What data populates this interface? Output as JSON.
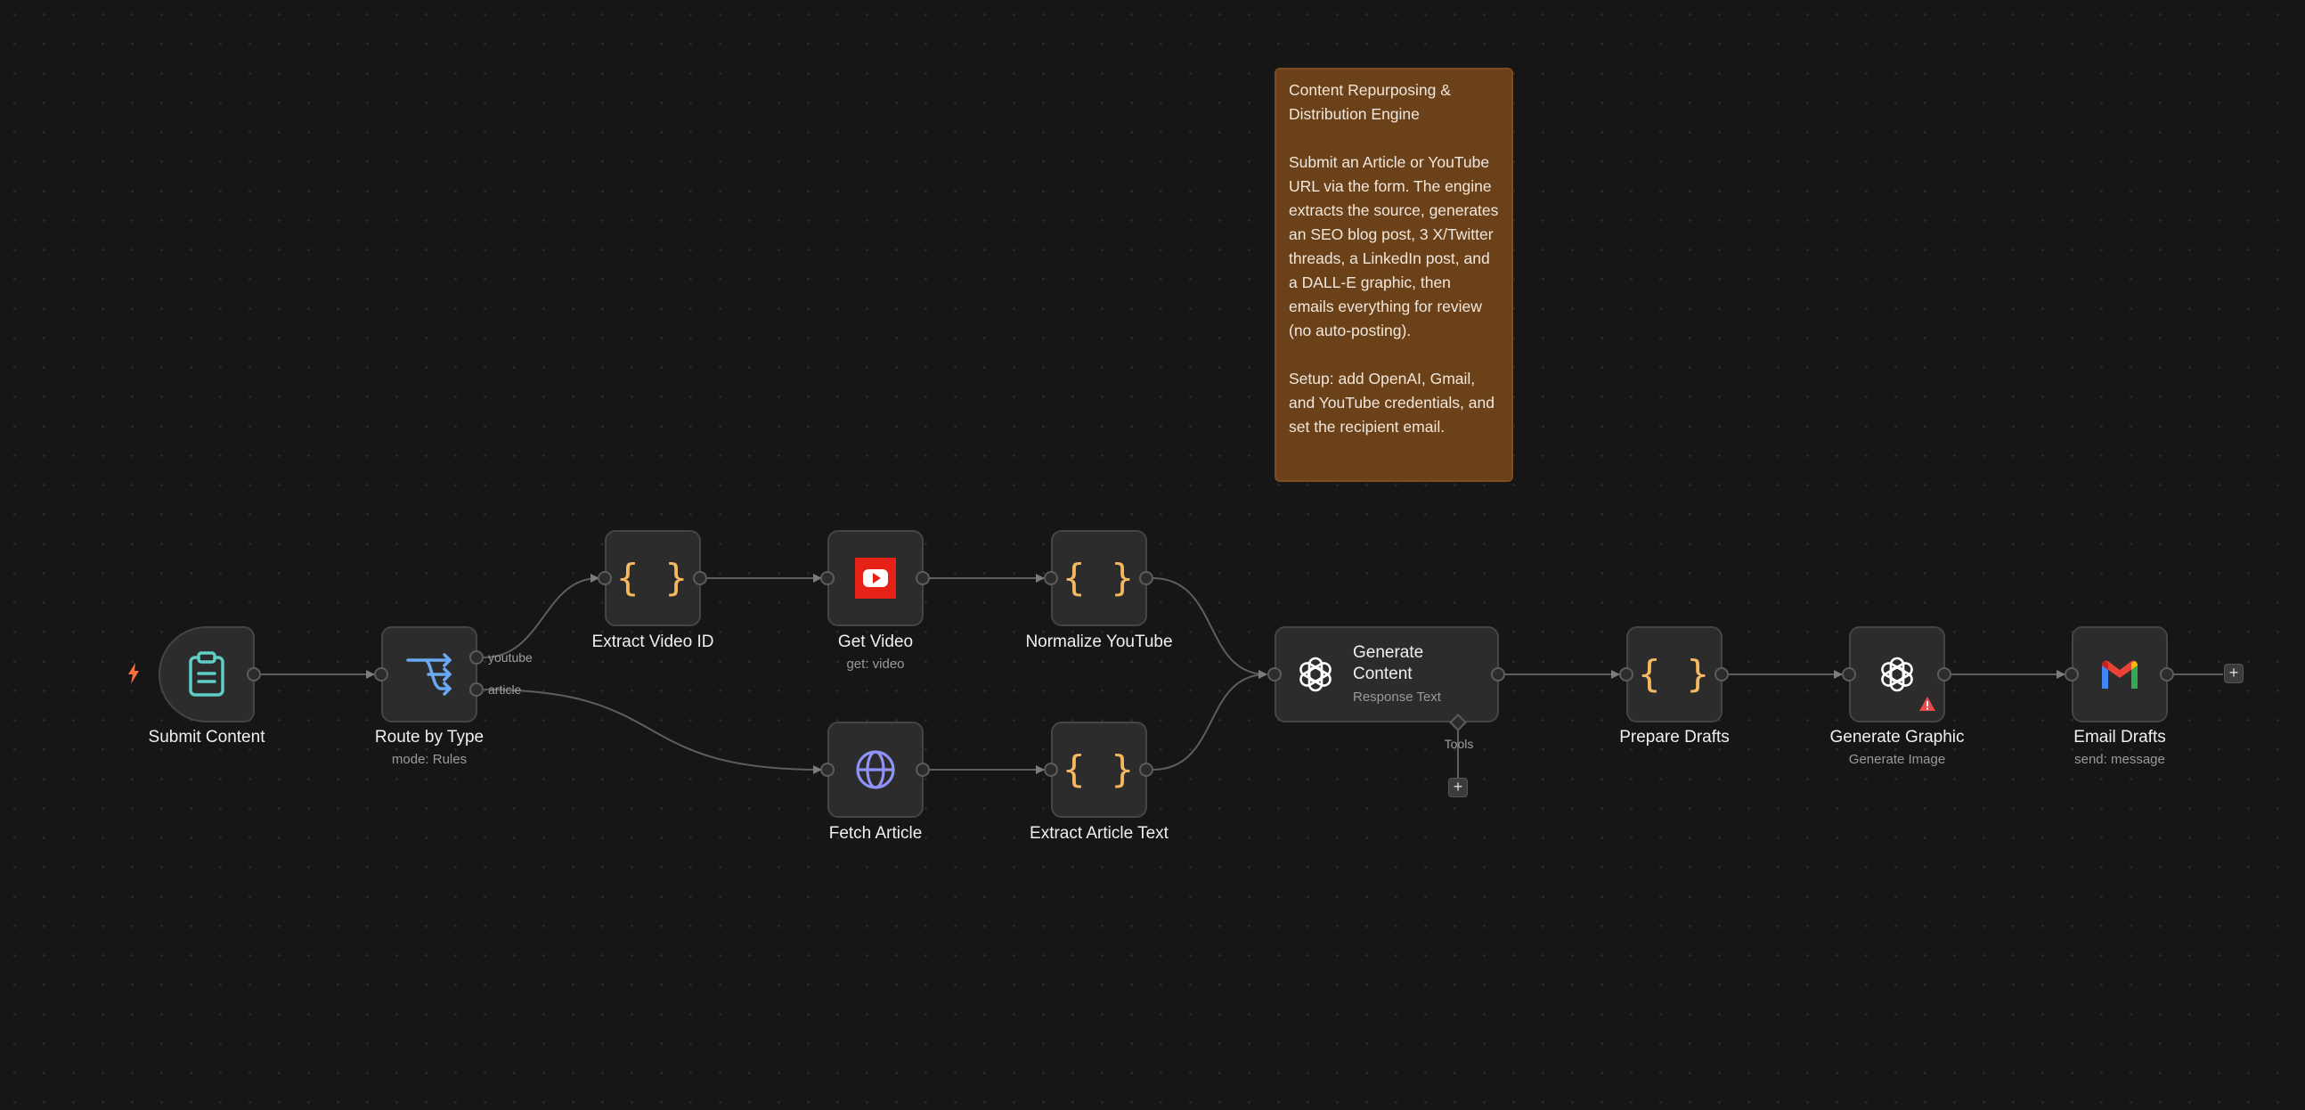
{
  "workflow": {
    "sticky_note": {
      "title": "Content Repurposing & Distribution Engine",
      "body": "Submit an Article or YouTube URL via the form. The engine extracts the source, generates an SEO blog post, 3 X/Twitter threads, a LinkedIn post, and a DALL-E graphic, then emails everything for review (no auto-posting).",
      "setup": "Setup: add OpenAI, Gmail, and YouTube credentials, and set the recipient email."
    },
    "nodes": {
      "submit_content": {
        "label": "Submit Content",
        "icon": "clipboard-icon"
      },
      "route_by_type": {
        "label": "Route by Type",
        "subtitle": "mode: Rules",
        "icon": "switch-icon",
        "outputs": [
          "youtube",
          "article"
        ]
      },
      "extract_video_id": {
        "label": "Extract Video ID",
        "icon": "code-braces-icon",
        "glyph": "{ }"
      },
      "get_video": {
        "label": "Get Video",
        "subtitle": "get: video",
        "icon": "youtube-icon"
      },
      "normalize_youtube": {
        "label": "Normalize YouTube",
        "icon": "code-braces-icon",
        "glyph": "{ }"
      },
      "fetch_article": {
        "label": "Fetch Article",
        "icon": "globe-icon"
      },
      "extract_article_text": {
        "label": "Extract Article Text",
        "icon": "code-braces-icon",
        "glyph": "{ }"
      },
      "generate_content": {
        "label": "Generate Content",
        "subtitle": "Response Text",
        "icon": "openai-icon",
        "tools_label": "Tools"
      },
      "prepare_drafts": {
        "label": "Prepare Drafts",
        "icon": "code-braces-icon",
        "glyph": "{ }"
      },
      "generate_graphic": {
        "label": "Generate Graphic",
        "subtitle": "Generate Image",
        "icon": "openai-icon",
        "warning": "warning-icon"
      },
      "email_drafts": {
        "label": "Email Drafts",
        "subtitle": "send: message",
        "icon": "gmail-icon"
      }
    },
    "add_button": "+"
  },
  "colors": {
    "canvas": "#161616",
    "node_bg": "#2c2c2c",
    "sticky_bg": "#6b4119",
    "code_icon": "#f4b860",
    "clipboard_icon": "#5fcfc6",
    "switch_icon": "#6aa9f0",
    "globe_icon": "#8f93f5",
    "youtube_red": "#e62117",
    "warning_red": "#ea4b4b",
    "trigger_bolt": "#ff6d3b"
  }
}
